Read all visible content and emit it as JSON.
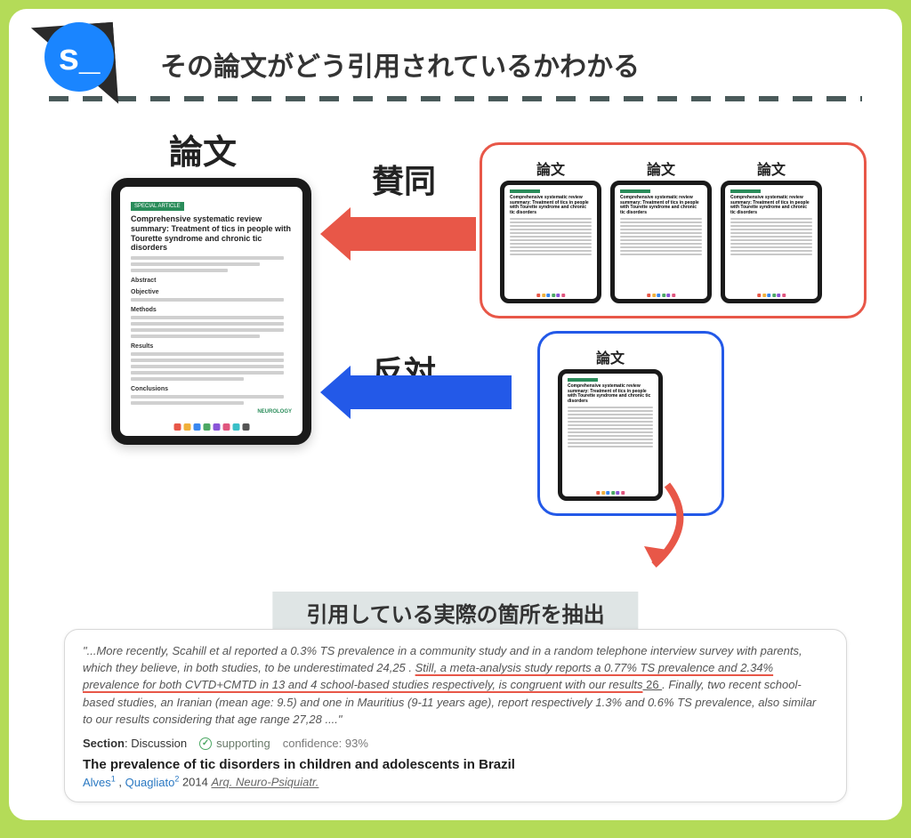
{
  "badge": "s_",
  "title": "その論文がどう引用されているかわかる",
  "labels": {
    "paper": "論文",
    "agree": "賛同",
    "disagree": "反対"
  },
  "main_paper": {
    "badge": "SPECIAL ARTICLE",
    "title": "Comprehensive systematic review summary: Treatment of tics in people with Tourette syndrome and chronic tic disorders",
    "sections": {
      "abstract": "Abstract",
      "objective": "Objective",
      "methods": "Methods",
      "results": "Results",
      "conclusions": "Conclusions"
    },
    "journal": "NEUROLOGY"
  },
  "citing_agree": [
    {
      "label": "論文",
      "title": "Comprehensive systematic review summary: Treatment of tics in people with Tourette syndrome and chronic tic disorders"
    },
    {
      "label": "論文",
      "title": "Comprehensive systematic review summary: Treatment of tics in people with Tourette syndrome and chronic tic disorders"
    },
    {
      "label": "論文",
      "title": "Comprehensive systematic review summary: Treatment of tics in people with Tourette syndrome and chronic tic disorders"
    }
  ],
  "citing_disagree": [
    {
      "label": "論文",
      "title": "Comprehensive systematic review summary: Treatment of tics in people with Tourette syndrome and chronic tic disorders"
    }
  ],
  "extract": {
    "header": "引用している実際の箇所を抽出",
    "quote_prefix": "\"...More recently, Scahill et al reported a 0.3% TS prevalence in a community study and in a random telephone interview survey with parents, which they believe, in both studies, to be underestimated 24,25 . ",
    "quote_highlight": "Still, a meta-analysis study reports a 0.77% TS prevalence and 2.34% prevalence for both CVTD+CMTD in 13 and 4 school-based studies respectively, is congruent with our results",
    "quote_ref": "  26  ",
    "quote_suffix": ". Finally, two recent school-based studies, an Iranian (mean age: 9.5) and one in Mauritius (9-11 years age), report respectively 1.3% and 0.6% TS prevalence, also similar to our results considering that age range 27,28 ....\"",
    "section_label": "Section",
    "section": "Discussion",
    "supporting": "supporting",
    "confidence_label": "confidence:",
    "confidence": "93%",
    "title": "The prevalence of tic disorders in children and adolescents in Brazil",
    "authors": {
      "a1": "Alves",
      "s1": "1",
      "a2": "Quagliato",
      "s2": "2"
    },
    "year": "2014",
    "journal": "Arq. Neuro-Psiquiatr."
  },
  "colors": {
    "agree": "#e85748",
    "disagree": "#2359e8",
    "journal": "#2a8c5a"
  }
}
